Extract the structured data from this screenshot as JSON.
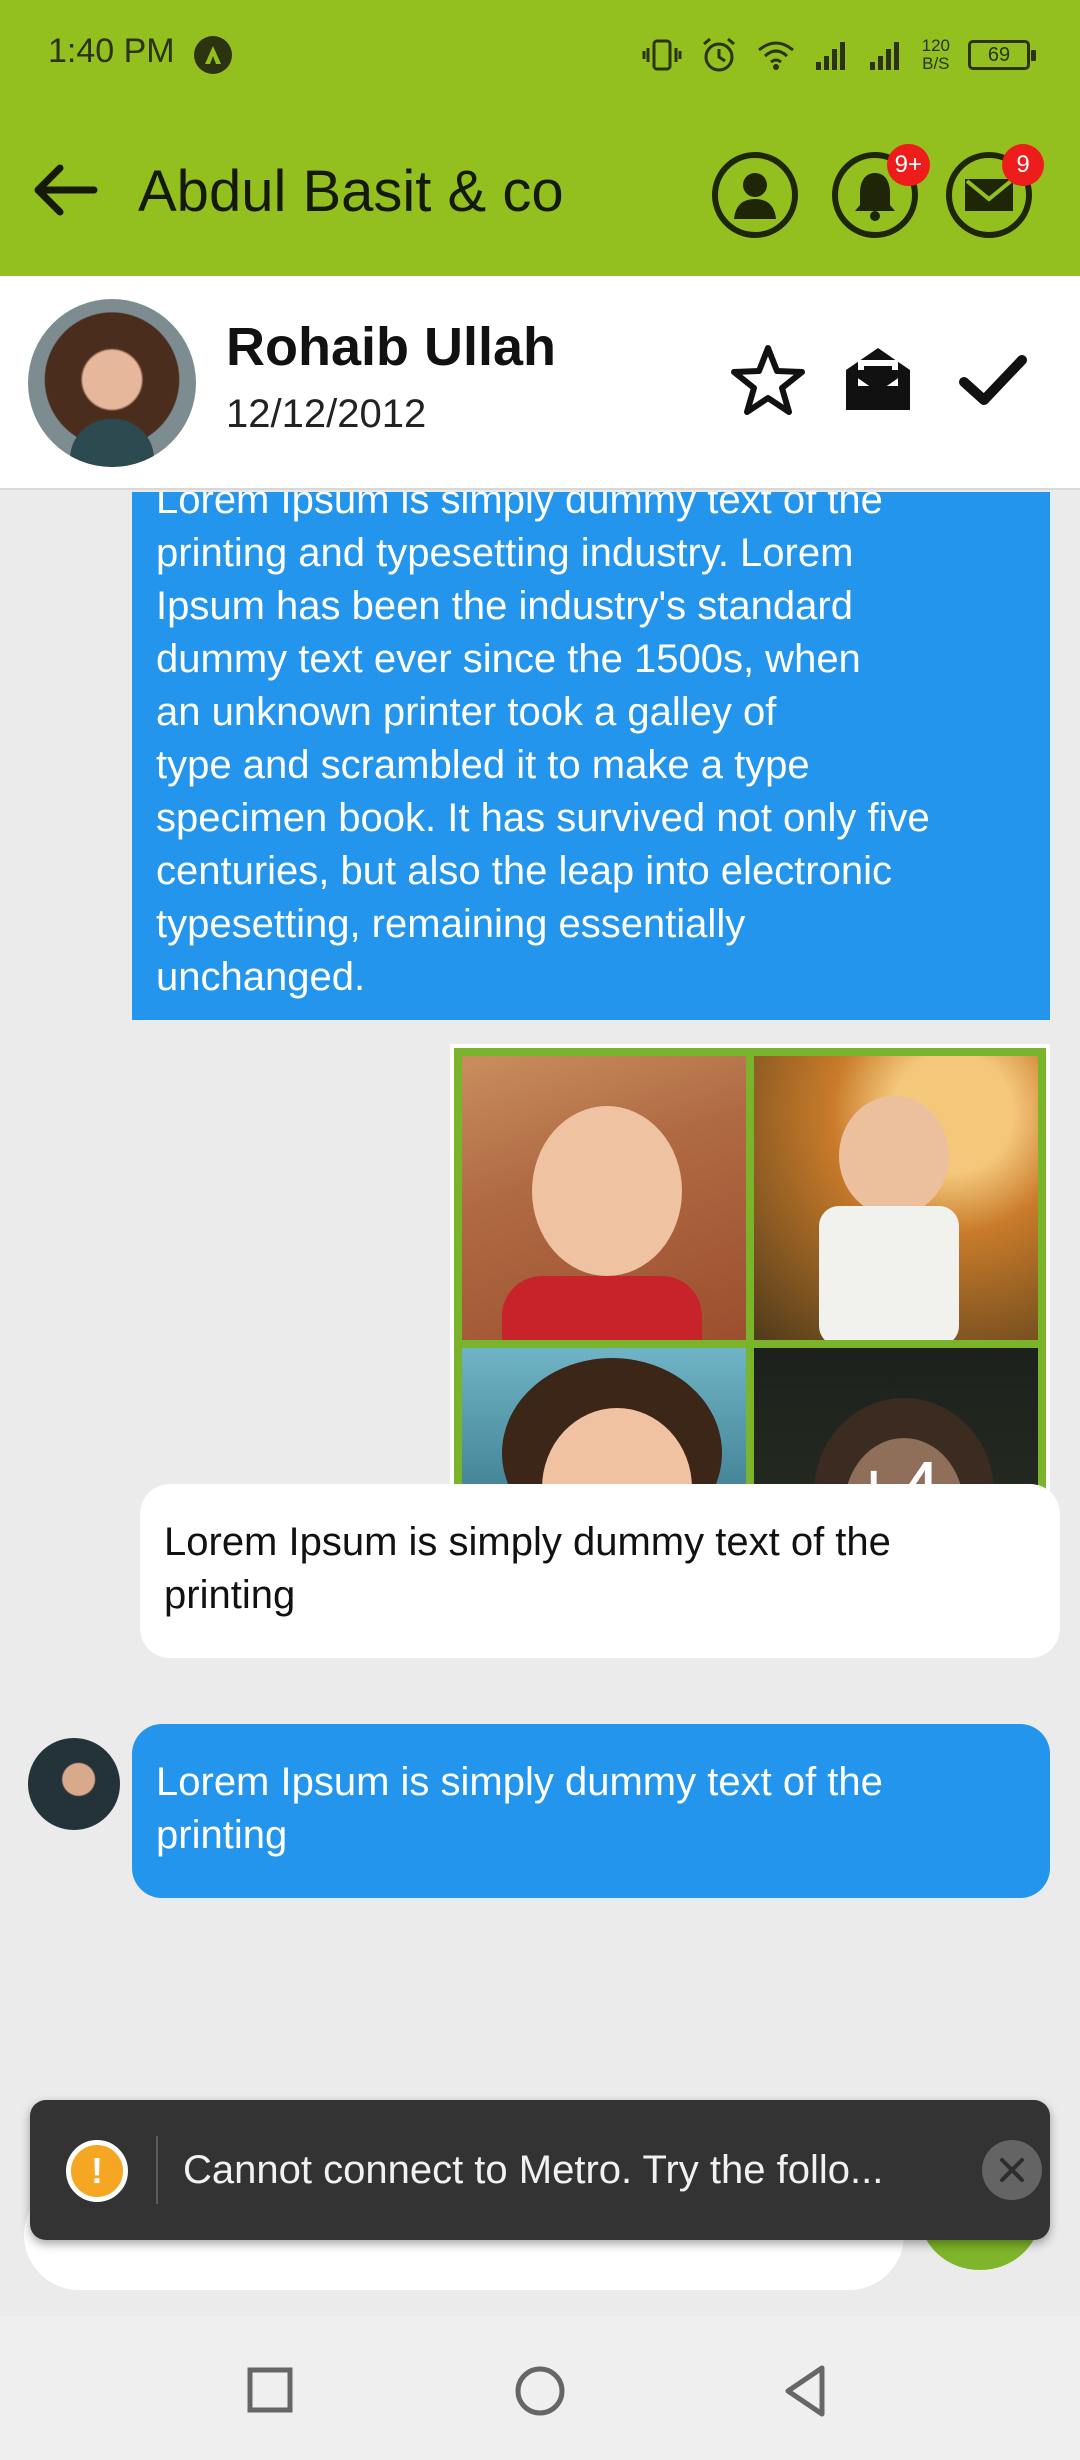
{
  "status_bar": {
    "time": "1:40 PM",
    "speed_value": "120",
    "speed_unit": "B/S",
    "battery": "69"
  },
  "header": {
    "title": "Abdul Basit & co",
    "notifications_badge": "9+",
    "messages_badge": "9",
    "color": "#93c01f"
  },
  "contact": {
    "name": "Rohaib Ullah",
    "date": "12/12/2012"
  },
  "messages": [
    {
      "direction": "outgoing",
      "lines": [
        "Lorem Ipsum is simply dummy text of the",
        "printing and typesetting industry. Lorem",
        "Ipsum has been the industry's standard",
        "dummy text ever since the 1500s, when",
        "an unknown printer took a galley of",
        "type and scrambled it to make a type",
        "specimen book. It has survived not only five",
        "centuries, but also the leap into electronic",
        "typesetting, remaining essentially",
        "unchanged."
      ]
    },
    {
      "direction": "outgoing",
      "type": "gallery",
      "more_label": "+4"
    },
    {
      "direction": "incoming",
      "lines": [
        "Lorem Ipsum is simply dummy text of the",
        "printing"
      ]
    },
    {
      "direction": "outgoing",
      "lines": [
        "Lorem Ipsum is simply dummy text of the",
        "printing"
      ]
    }
  ],
  "toast": {
    "text": "Cannot connect to Metro.  Try the follo..."
  },
  "colors": {
    "outgoing_bubble": "#2395ec",
    "incoming_bubble": "#ffffff",
    "gallery_border": "#79b42a"
  }
}
